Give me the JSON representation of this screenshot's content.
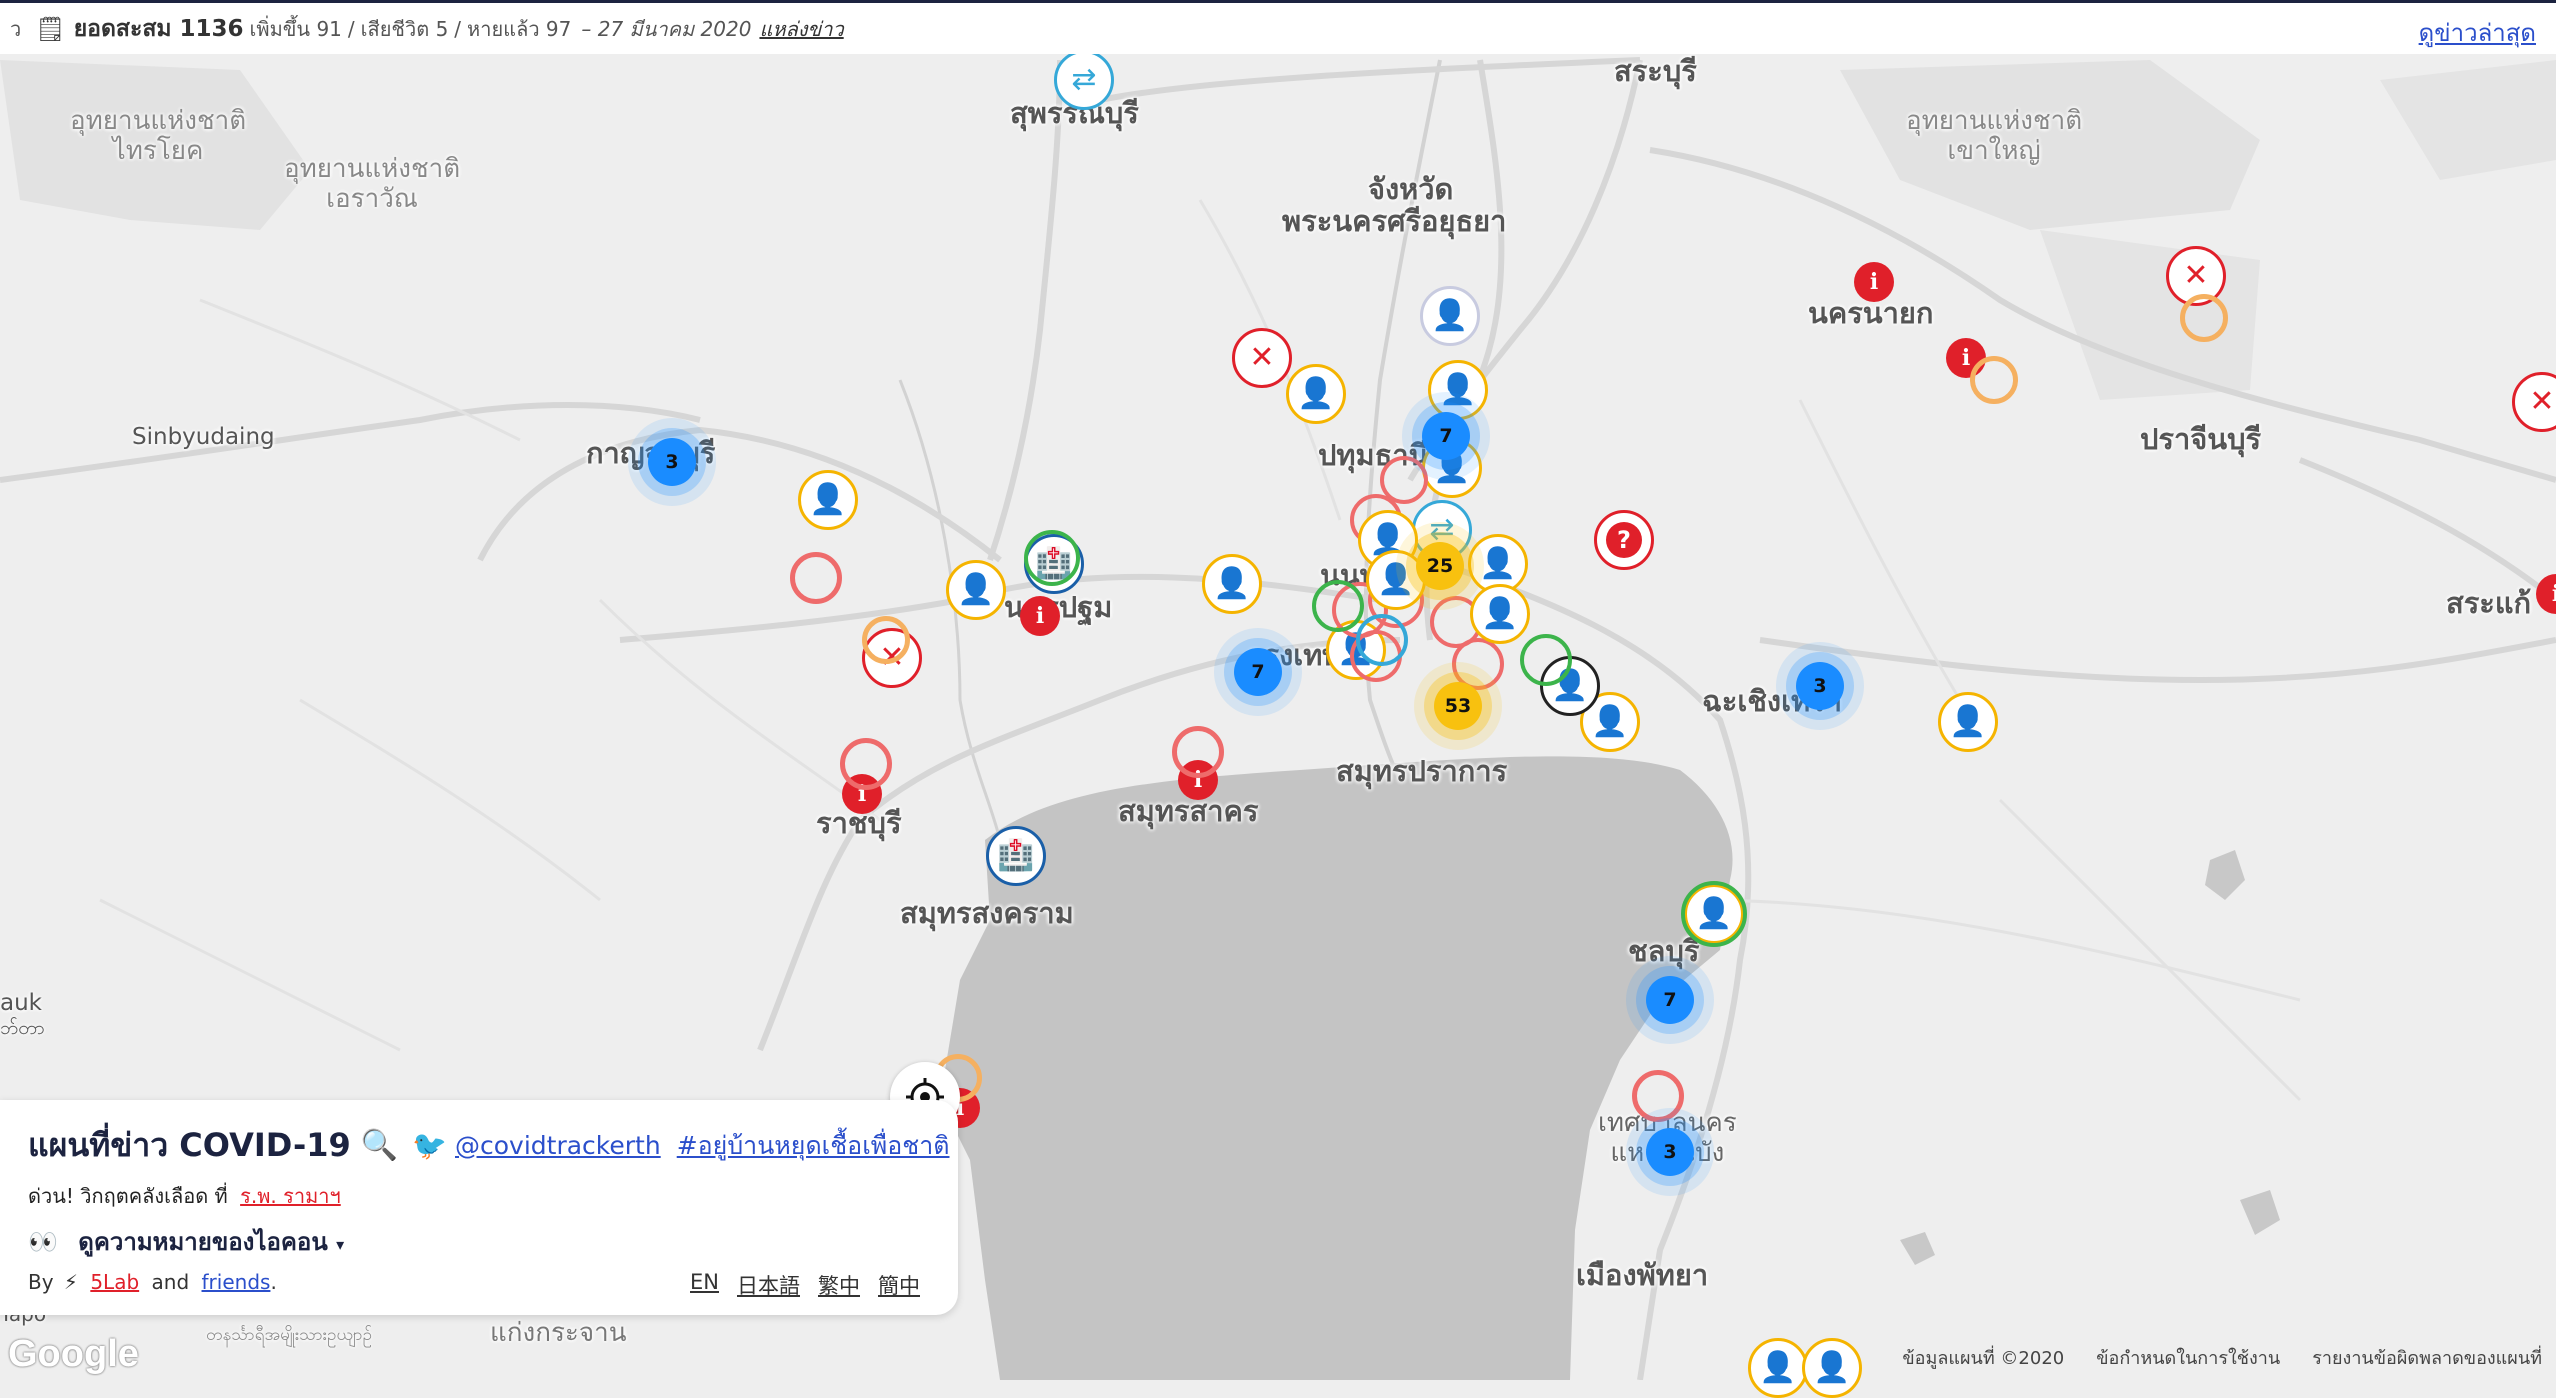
{
  "topbar": {
    "left_glyph": "ว",
    "icon": "notepad-icon",
    "title": "ยอดสะสม 1136",
    "increase": "เพิ่มขึ้น 91",
    "sep1": "/",
    "deaths": "เสียชีวิต 5",
    "sep2": "/",
    "recovered": "หายแล้ว 97",
    "date": "– 27 มีนาคม 2020",
    "source_link": "แหล่งข่าว",
    "latest_news": "ดูข่าวล่าสุด"
  },
  "places": {
    "saraburi": "สระบุรี",
    "suphanburi": "สุพรรณบุรี",
    "ayutthaya_1": "จังหวัด",
    "ayutthaya_2": "พระนครศรีอยุธยา",
    "sai_yok_1": "อุทยานแห่งชาติ",
    "sai_yok_2": "ไทรโยค",
    "erawan_1": "อุทยานแห่งชาติ",
    "erawan_2": "เอราวัณ",
    "khao_yai_1": "อุทยานแห่งชาติ",
    "khao_yai_2": "เขาใหญ่",
    "nakhon_nayok": "นครนายก",
    "sinbyudaing": "Sinbyudaing",
    "kanchanaburi": "กาญจนบุรี",
    "pathum_thani": "ปทุมธานี",
    "prachinburi": "ปราจีนบุรี",
    "nakhon_pathom": "นครปฐม",
    "nonthaburi": "นนท",
    "sa_kaeo": "สระแก้",
    "bangkok": "กรุงเทพ",
    "chachoengsao": "ฉะเชิงเทรา",
    "samut_prakan": "สมุทรปราการ",
    "ratchaburi": "ราชบุรี",
    "samut_sakhon": "สมุทรสาคร",
    "samut_songkhram": "สมุทรสงคราม",
    "chonburi": "ชลบุรี",
    "lauk": "auk",
    "lauk_mm": "ဘ်တာ",
    "laem_chabang_1": "เทศบาลนคร",
    "laem_chabang_2": "แหลมฉบัง",
    "pattaya": "เมืองพัทยา",
    "kaeng_krachan": "แก่งกระจาน",
    "tapo": "Tapo",
    "myanmar_footer": "တနင်္သာရီအမျိုးသားဥယျာဉ်"
  },
  "clusters": [
    {
      "name": "kanchanaburi",
      "count": "3",
      "color": "blue"
    },
    {
      "name": "pathum-thani",
      "count": "7",
      "color": "blue"
    },
    {
      "name": "bangkok-west",
      "count": "7",
      "color": "blue"
    },
    {
      "name": "bangkok-center",
      "count": "25",
      "color": "yellow"
    },
    {
      "name": "samut-prakan",
      "count": "53",
      "color": "yellow"
    },
    {
      "name": "chachoengsao",
      "count": "3",
      "color": "blue"
    },
    {
      "name": "chonburi",
      "count": "7",
      "color": "blue"
    },
    {
      "name": "laem-chabang",
      "count": "3",
      "color": "blue"
    }
  ],
  "panel": {
    "title": "แผนที่ข่าว COVID-19",
    "twitter_handle": "@covidtrackerth",
    "hashtag": "#อยู่บ้านหยุดเชื้อเพื่อชาติ",
    "urgent_prefix": "ด่วน! วิกฤตคลังเลือด ที่",
    "urgent_link": "ร.พ. รามาฯ",
    "eyes": "👀",
    "legend_toggle": "ดูความหมายของไอคอน",
    "legend_caret": "▾",
    "by": "By",
    "bolt": "⚡",
    "lab": "5Lab",
    "and": "and",
    "friends": "friends",
    "period": ".",
    "lang_en": "EN",
    "lang_ja": "日本語",
    "lang_zht": "繁中",
    "lang_zhs": "簡中"
  },
  "footer": {
    "map_data": "ข้อมูลแผนที่ ©2020",
    "terms": "ข้อกำหนดในการใช้งาน",
    "report": "รายงานข้อผิดพลาดของแผนที่"
  },
  "google": "Google",
  "colors": {
    "red": "#e0202a",
    "yellow": "#f5b400",
    "blue": "#1a8cff",
    "sea": "#c4c4c4",
    "land": "#eeeeee",
    "topbar_border": "#1c2340",
    "link": "#2b4fcb"
  }
}
